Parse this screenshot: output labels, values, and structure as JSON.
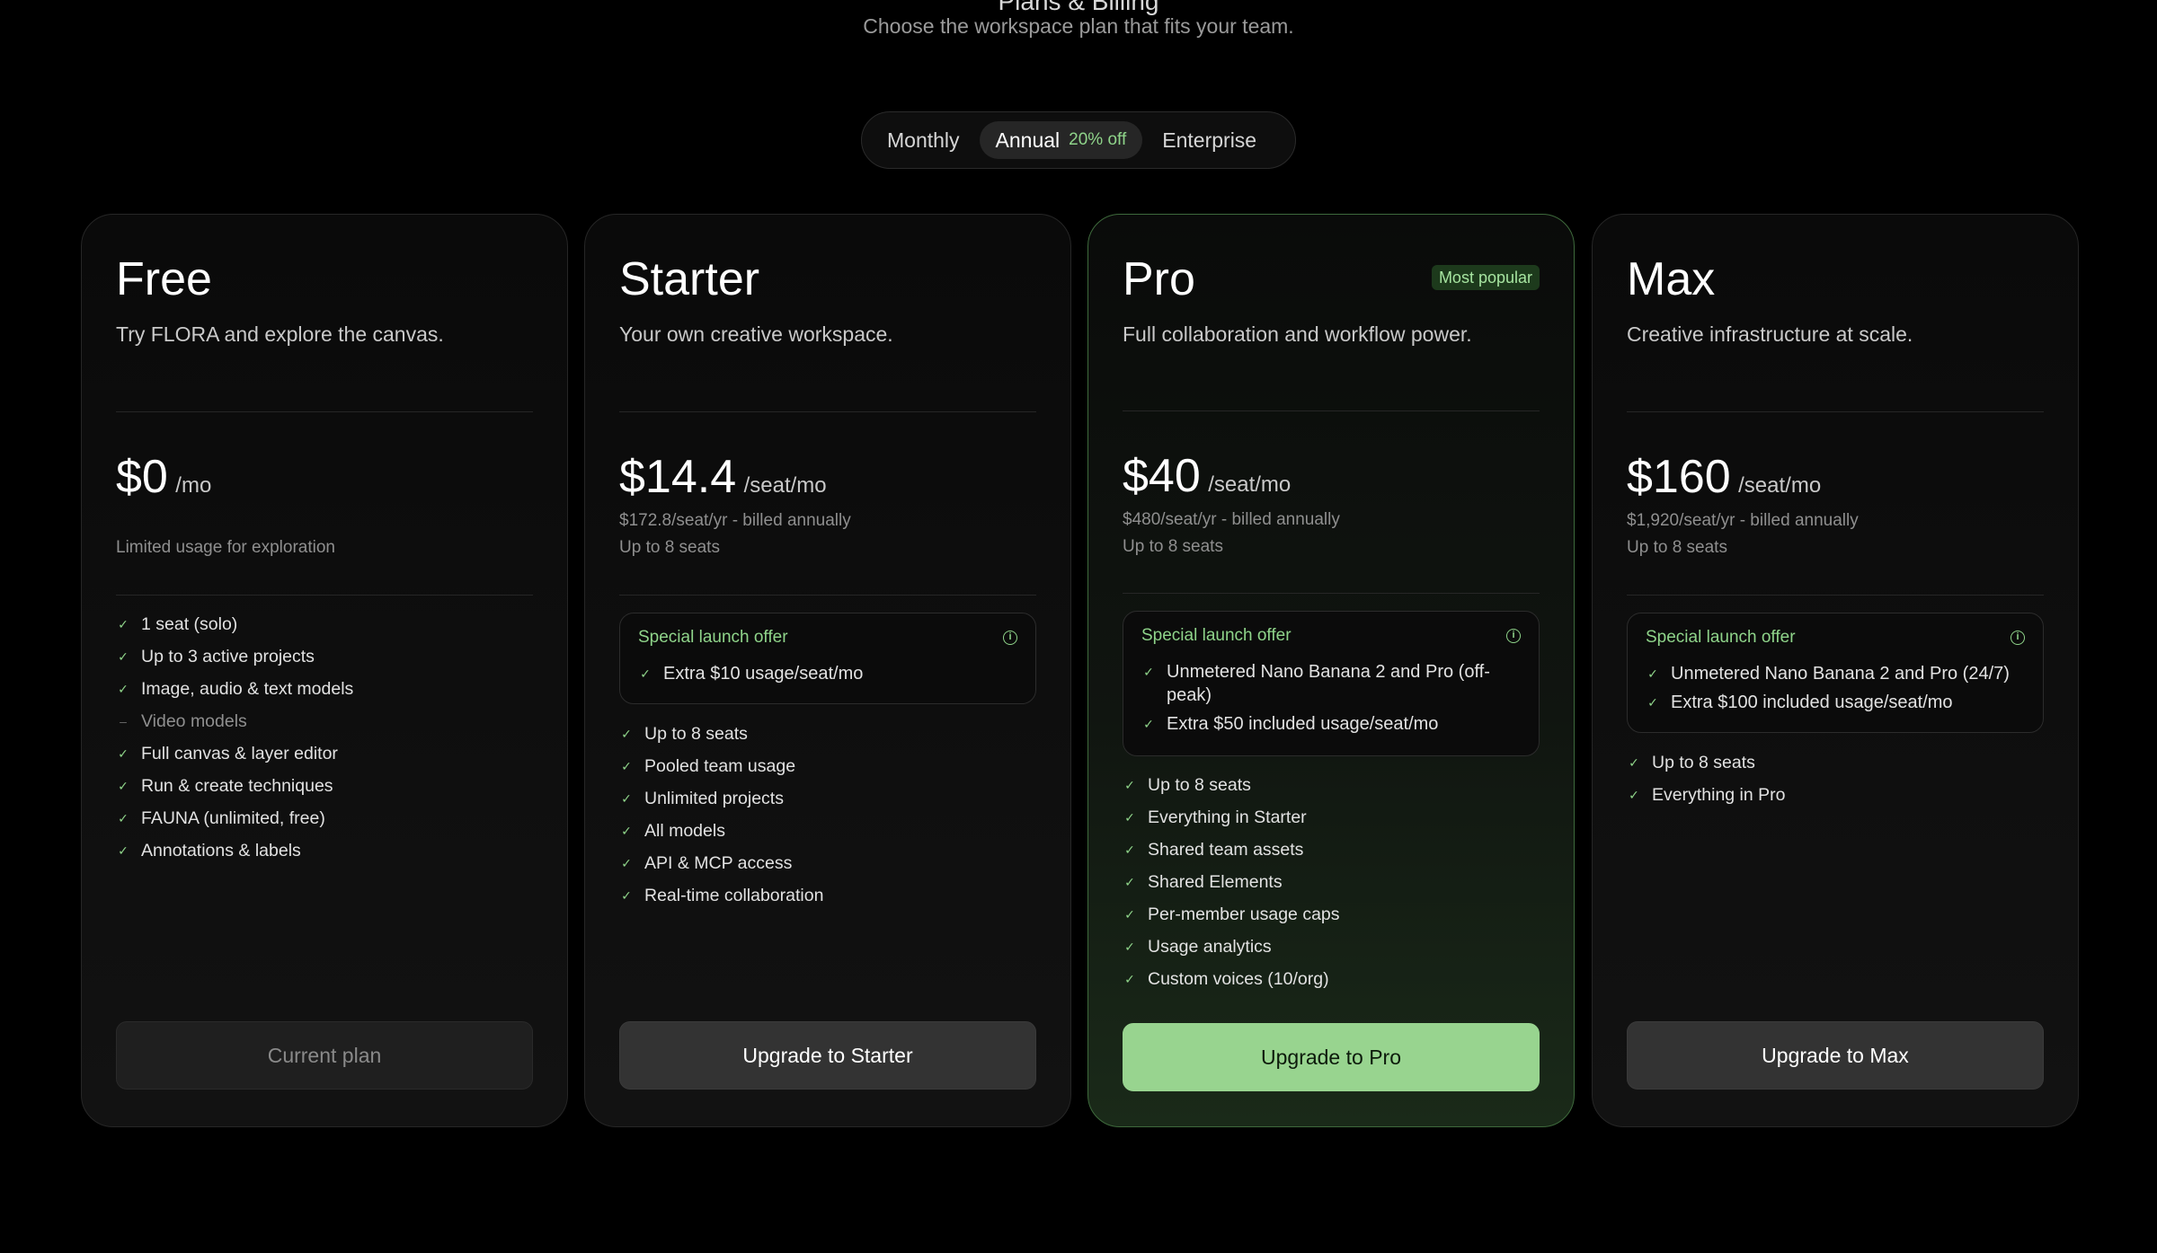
{
  "header": {
    "title": "Plans & Billing",
    "subtitle": "Choose the workspace plan that fits your team."
  },
  "billing_toggle": {
    "options": [
      "Monthly",
      "Annual",
      "Enterprise"
    ],
    "selected": "Annual",
    "annual_discount": "20% off"
  },
  "colors": {
    "accent": "#98d48f",
    "background": "#000000"
  },
  "plans": [
    {
      "name": "Free",
      "description": "Try FLORA and explore the canvas.",
      "price": "$0",
      "unit": "/mo",
      "note": "Limited usage for exploration",
      "features": [
        {
          "text": "1 seat (solo)",
          "included": true
        },
        {
          "text": "Up to 3 active projects",
          "included": true
        },
        {
          "text": "Image, audio & text models",
          "included": true
        },
        {
          "text": "Video models",
          "included": false
        },
        {
          "text": "Full canvas & layer editor",
          "included": true
        },
        {
          "text": "Run & create techniques",
          "included": true
        },
        {
          "text": "FAUNA (unlimited, free)",
          "included": true
        },
        {
          "text": "Annotations & labels",
          "included": true
        }
      ],
      "cta": "Current plan"
    },
    {
      "name": "Starter",
      "description": "Your own creative workspace.",
      "price": "$14.4",
      "unit": "/seat/mo",
      "billing": "$172.8/seat/yr - billed annually",
      "seats": "Up to 8 seats",
      "offer": {
        "title": "Special launch offer",
        "items": [
          "Extra $10 usage/seat/mo"
        ]
      },
      "features": [
        "Up to 8 seats",
        "Pooled team usage",
        "Unlimited projects",
        "All models",
        "API & MCP access",
        "Real-time collaboration"
      ],
      "cta": "Upgrade to Starter"
    },
    {
      "name": "Pro",
      "badge": "Most popular",
      "description": "Full collaboration and workflow power.",
      "price": "$40",
      "unit": "/seat/mo",
      "billing": "$480/seat/yr - billed annually",
      "seats": "Up to 8 seats",
      "offer": {
        "title": "Special launch offer",
        "items": [
          "Unmetered Nano Banana 2 and Pro (off-peak)",
          "Extra $50 included usage/seat/mo"
        ]
      },
      "features": [
        "Up to 8 seats",
        "Everything in Starter",
        "Shared team assets",
        "Shared Elements",
        "Per-member usage caps",
        "Usage analytics",
        "Custom voices (10/org)"
      ],
      "cta": "Upgrade to Pro"
    },
    {
      "name": "Max",
      "description": "Creative infrastructure at scale.",
      "price": "$160",
      "unit": "/seat/mo",
      "billing": "$1,920/seat/yr - billed annually",
      "seats": "Up to 8 seats",
      "offer": {
        "title": "Special launch offer",
        "items": [
          "Unmetered Nano Banana 2 and Pro (24/7)",
          "Extra $100 included usage/seat/mo"
        ]
      },
      "features": [
        "Up to 8 seats",
        "Everything in Pro"
      ],
      "cta": "Upgrade to Max"
    }
  ]
}
